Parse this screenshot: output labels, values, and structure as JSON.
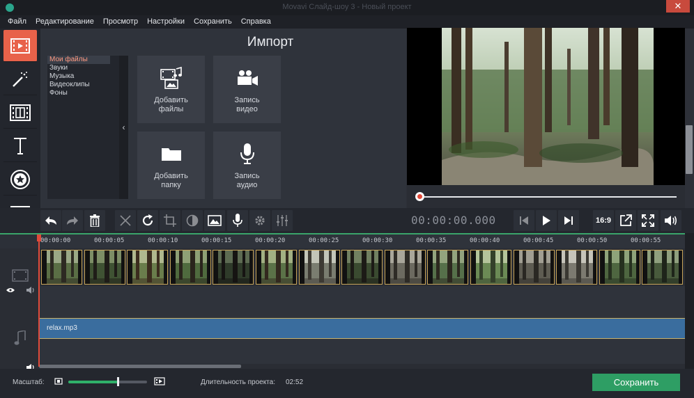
{
  "window": {
    "title": "Movavi Слайд-шоу 3 - Новый проект",
    "close_label": "✕"
  },
  "menu": [
    "Файл",
    "Редактирование",
    "Просмотр",
    "Настройки",
    "Сохранить",
    "Справка"
  ],
  "sidebar": {
    "items": [
      {
        "name": "import",
        "icon": "film-import-icon",
        "active": true
      },
      {
        "name": "filters",
        "icon": "magic-wand-icon",
        "active": false
      },
      {
        "name": "transitions",
        "icon": "film-transition-icon",
        "active": false
      },
      {
        "name": "titles",
        "icon": "text-T-icon",
        "active": false
      },
      {
        "name": "stickers",
        "icon": "star-sticker-icon",
        "active": false
      },
      {
        "name": "more",
        "icon": "list-icon",
        "active": false
      }
    ]
  },
  "import_panel": {
    "title": "Импорт",
    "categories": [
      "Мои файлы",
      "Звуки",
      "Музыка",
      "Видеоклипы",
      "Фоны"
    ],
    "selected_category": "Мои файлы",
    "collapse_glyph": "‹",
    "tiles": [
      {
        "label": "Добавить файлы",
        "icon": "add-files-icon"
      },
      {
        "label": "Запись видео",
        "icon": "video-camera-icon"
      },
      {
        "label": "Добавить папку",
        "icon": "folder-icon"
      },
      {
        "label": "Запись аудио",
        "icon": "microphone-icon"
      }
    ]
  },
  "player": {
    "timecode": "00:00:00.000",
    "aspect_ratio": "16:9",
    "position_fraction": 0
  },
  "timeline": {
    "ruler_ticks": [
      "00:00:00",
      "00:00:05",
      "00:00:10",
      "00:00:15",
      "00:00:20",
      "00:00:25",
      "00:00:30",
      "00:00:35",
      "00:00:40",
      "00:00:45",
      "00:00:50",
      "00:00:55"
    ],
    "clip_count": 15,
    "audio_clip": "relax.mp3"
  },
  "footer": {
    "zoom_label": "Масштаб:",
    "zoom_level_fraction": 0.63,
    "duration_label": "Длительность проекта:",
    "duration_value": "02:52",
    "save_label": "Сохранить"
  },
  "colors": {
    "accent": "#e8624a",
    "save": "#2e9e64",
    "audio_track": "#3a6d9e",
    "clip_border": "#c8a55a",
    "playhead": "#e04a3a"
  }
}
